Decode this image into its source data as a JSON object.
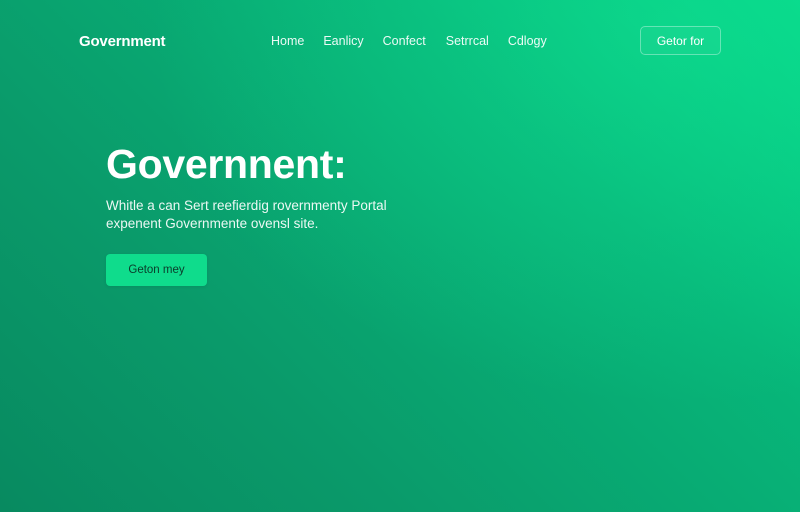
{
  "navbar": {
    "logo": "Government",
    "links": [
      "Home",
      "Eanlicy",
      "Confect",
      "Setrrcal",
      "Cdlogy"
    ],
    "cta_label": "Getor for"
  },
  "hero": {
    "title": "Governnent:",
    "subtitle_line1": "Whitle a can Sert reefierdig rovernmenty Portal",
    "subtitle_line2": "expenent Governmente ovensl site.",
    "cta_label": "Geton mey"
  },
  "colors": {
    "background_start": "#04d688",
    "background_end": "#088a60",
    "cta_button": "#0fdc8c"
  }
}
